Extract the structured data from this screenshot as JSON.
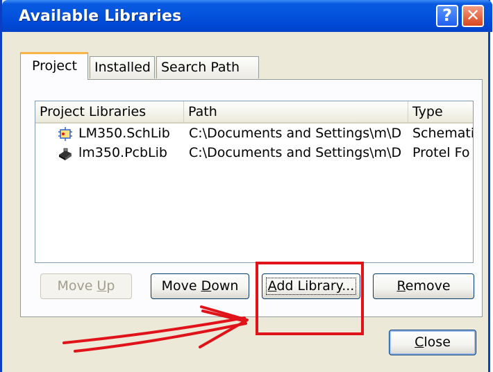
{
  "window": {
    "title": "Available Libraries"
  },
  "tabs": [
    {
      "label": "Project",
      "active": true
    },
    {
      "label": "Installed",
      "active": false
    },
    {
      "label": "Search Path",
      "active": false
    }
  ],
  "list": {
    "columns": [
      "Project Libraries",
      "Path",
      "Type"
    ],
    "rows": [
      {
        "icon": "schematic-library-icon",
        "name": "LM350.SchLib",
        "path": "C:\\Documents and Settings\\m\\D",
        "type": "Schemati"
      },
      {
        "icon": "pcb-library-icon",
        "name": "lm350.PcbLib",
        "path": "C:\\Documents and Settings\\m\\D",
        "type": "Protel Fo"
      }
    ]
  },
  "buttons": {
    "move_up": {
      "pre": "Move ",
      "key": "U",
      "post": "p",
      "enabled": false
    },
    "move_down": {
      "pre": "Move ",
      "key": "D",
      "post": "own",
      "enabled": true
    },
    "add_library": {
      "pre": "",
      "key": "A",
      "post": "dd Library...",
      "enabled": true
    },
    "remove": {
      "pre": "",
      "key": "R",
      "post": "emove",
      "enabled": true
    },
    "close": {
      "pre": "",
      "key": "C",
      "post": "lose",
      "enabled": true
    }
  },
  "annotation": {
    "color": "#e0131b",
    "shapes": [
      "highlight-box",
      "arrow"
    ]
  },
  "colors": {
    "titlebar": "#0454dd",
    "active_tab_accent": "#f8b245",
    "dialog_bg": "#ece9d8"
  }
}
